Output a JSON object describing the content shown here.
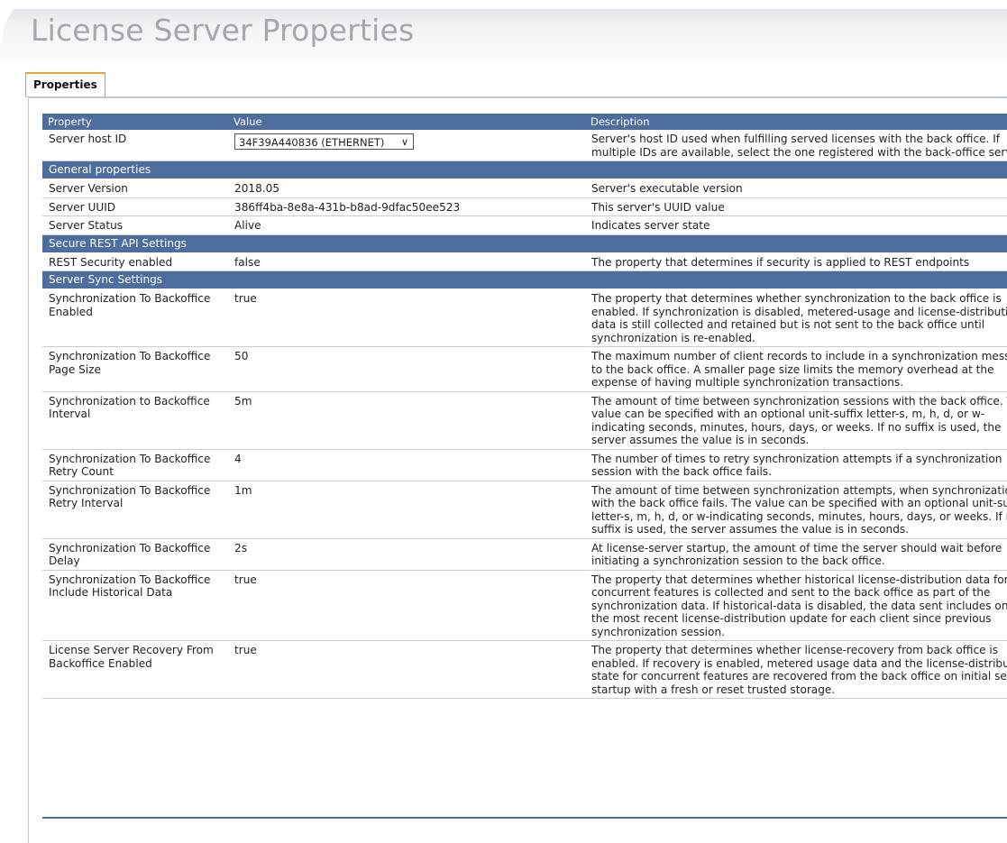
{
  "page": {
    "title": "License Server Properties"
  },
  "tabs": [
    {
      "label": "Properties"
    }
  ],
  "table": {
    "headers": [
      "Property",
      "Value",
      "Description"
    ],
    "host_row": {
      "property": "Server host ID",
      "value": "34F39A440836 (ETHERNET)",
      "description": "Server's host ID used when fulfilling served licenses with the back office. If multiple IDs are available, select the one registered with the back-office server."
    },
    "sections": [
      {
        "name": "General properties",
        "rows": [
          {
            "property": "Server Version",
            "value": "2018.05",
            "description": "Server's executable version"
          },
          {
            "property": "Server UUID",
            "value": "386ff4ba-8e8a-431b-b8ad-9dfac50ee523",
            "description": "This server's UUID value"
          },
          {
            "property": "Server Status",
            "value": "Alive",
            "description": "Indicates server state"
          }
        ]
      },
      {
        "name": "Secure REST API Settings",
        "rows": [
          {
            "property": "REST Security enabled",
            "value": "false",
            "description": "The property that determines if security is applied to REST endpoints"
          }
        ]
      },
      {
        "name": "Server Sync Settings",
        "rows": [
          {
            "property": "Synchronization To Backoffice Enabled",
            "value": "true",
            "description": "The property that determines whether synchronization to the back office is enabled. If synchronization is disabled, metered-usage and license-distribution data is still collected and retained but is not sent to the back office until synchronization is re-enabled."
          },
          {
            "property": "Synchronization To Backoffice Page Size",
            "value": "50",
            "description": "The maximum number of client records to include in a synchronization message to the back office. A smaller page size limits the memory overhead at the expense of having multiple synchronization transactions."
          },
          {
            "property": "Synchronization to Backoffice Interval",
            "value": "5m",
            "description": "The amount of time between synchronization sessions with the back office. The value can be specified with an optional unit-suffix letter-s, m, h, d, or w-indicating seconds, minutes, hours, days, or weeks. If no suffix is used, the server assumes the value is in seconds."
          },
          {
            "property": "Synchronization To Backoffice Retry Count",
            "value": "4",
            "description": "The number of times to retry synchronization attempts if a synchronization session with the back office fails."
          },
          {
            "property": "Synchronization To Backoffice Retry Interval",
            "value": "1m",
            "description": "The amount of time between synchronization attempts, when synchronization with the back office fails. The value can be specified with an optional unit-suffix letter-s, m, h, d, or w-indicating seconds, minutes, hours, days, or weeks. If no suffix is used, the server assumes the value is in seconds."
          },
          {
            "property": "Synchronization To Backoffice Delay",
            "value": "2s",
            "description": "At license-server startup, the amount of time the server should wait before initiating a synchronization session to the back office."
          },
          {
            "property": "Synchronization To Backoffice Include Historical Data",
            "value": "true",
            "description": "The property that determines whether historical license-distribution data for concurrent features is collected and sent to the back office as part of the synchronization data. If historical-data is disabled, the data sent includes only the most recent license-distribution update for each client since previous synchronization session."
          },
          {
            "property": "License Server Recovery From Backoffice Enabled",
            "value": "true",
            "description": "The property that determines whether license-recovery from back office is enabled. If recovery is enabled, metered usage data and the license-distribution state for concurrent features are recovered from the back office on initial server startup with a fresh or reset trusted storage."
          }
        ]
      }
    ]
  }
}
